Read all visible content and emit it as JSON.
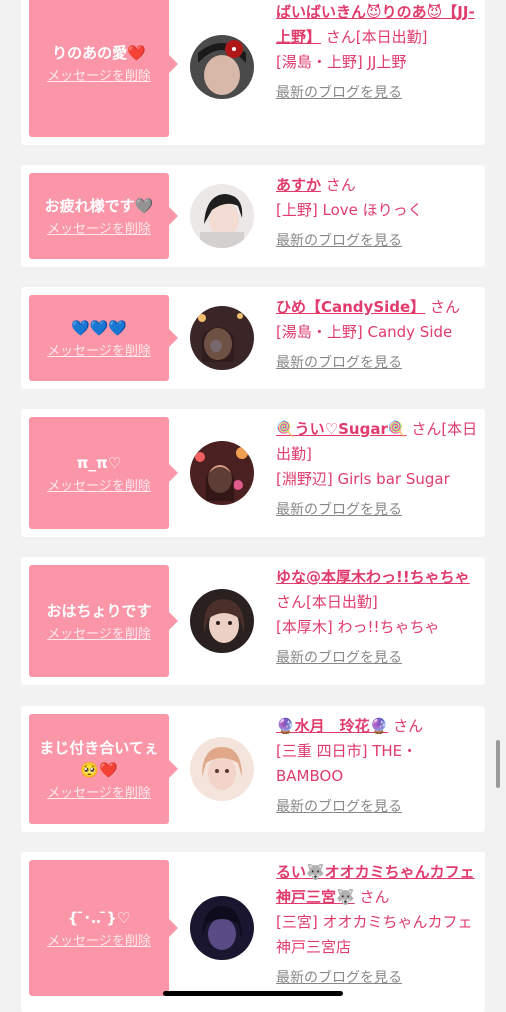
{
  "delete_label": "メッセージを削除",
  "blog_label": "最新のブログを見る",
  "cards": [
    {
      "message": "りのあの愛❤️",
      "name": "ばいばいきん😈りのあ😈【JJ-上野】",
      "suffix": "さん[本日出勤]",
      "shop": "[湯島・上野] JJ上野",
      "avatar_colors": [
        "#3a3a3a",
        "#d8b8a8"
      ]
    },
    {
      "message": "お疲れ様です🩶",
      "name": "あすか",
      "suffix": "さん",
      "shop": "[上野] Love ほりっく",
      "avatar_colors": [
        "#e8e4e4",
        "#2c2c2c"
      ]
    },
    {
      "message": "💙💙💙",
      "name": "ひめ【CandySide】",
      "suffix": "さん",
      "shop": "[湯島・上野] Candy Side",
      "avatar_colors": [
        "#3c2a2a",
        "#c89a7a"
      ]
    },
    {
      "message": "π_π♡",
      "name": "🍭うい♡Sugar🍭",
      "suffix": "さん[本日出勤]",
      "shop": "[淵野辺] Girls bar Sugar",
      "avatar_colors": [
        "#5a2a2a",
        "#d86a6a"
      ]
    },
    {
      "message": "おはちょりです",
      "name": "ゆな@本厚木わっ!!ちゃちゃ",
      "suffix": "さん[本日出勤]",
      "shop": "[本厚木] わっ!!ちゃちゃ",
      "avatar_colors": [
        "#3a2a22",
        "#e8c8b8"
      ]
    },
    {
      "message": "まじ付き合いてぇ🥺❤️",
      "name": "🔮水月　玲花🔮",
      "suffix": "さん",
      "shop": "[三重 四日市] THE・BAMBOO",
      "avatar_colors": [
        "#f0dcd0",
        "#e4a890"
      ]
    },
    {
      "message": "{ ̄･‥ ̄}♡",
      "name": "るい🐺オオカミちゃんカフェ神戸三宮🐺",
      "suffix": "さん",
      "shop": "[三宮] オオカミちゃんカフェ神戸三宮店",
      "avatar_colors": [
        "#1e1a3a",
        "#6a5a9a"
      ]
    }
  ]
}
